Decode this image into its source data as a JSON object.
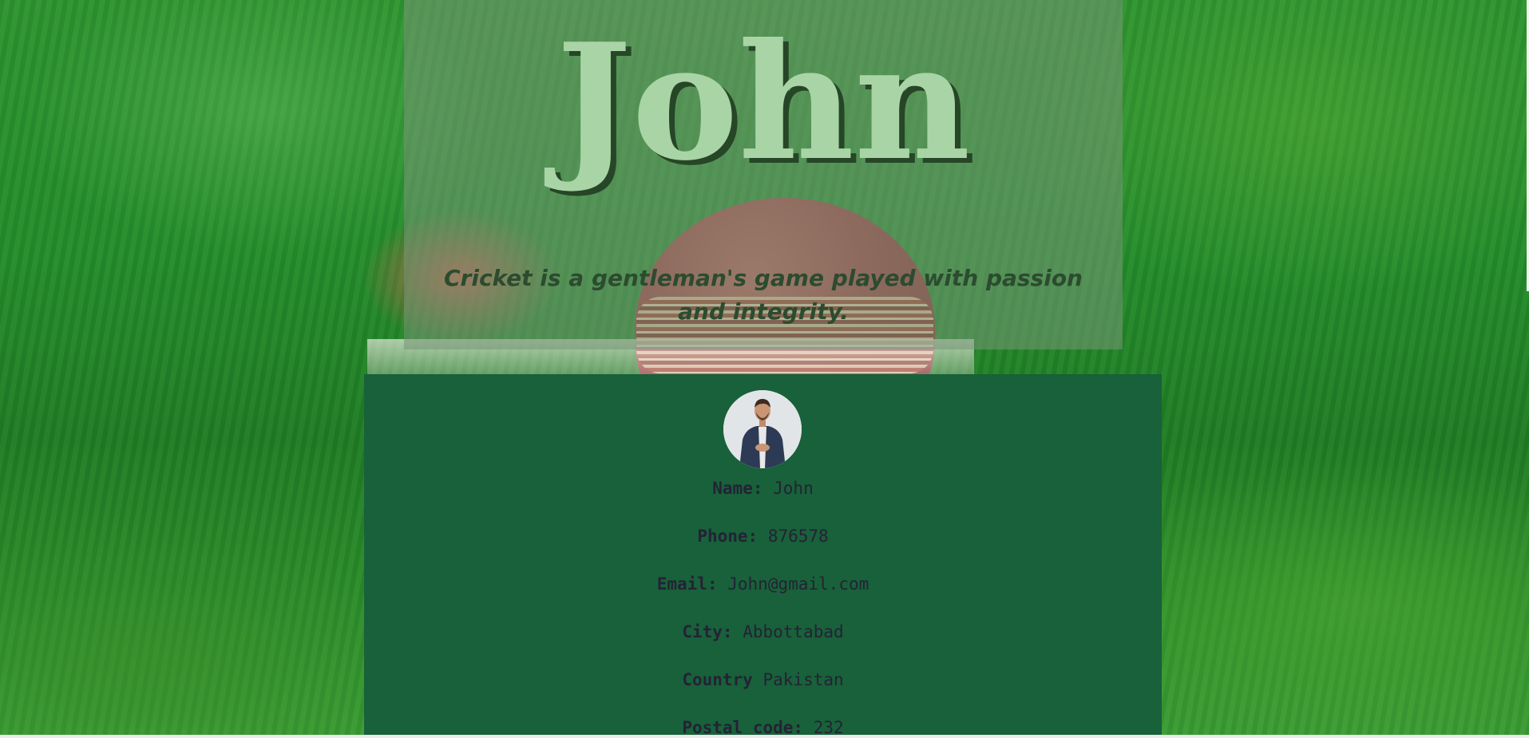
{
  "hero": {
    "title": "John",
    "tagline": "Cricket is a gentleman's game played with passion and integrity."
  },
  "profile": {
    "fields": [
      {
        "label": "Name:",
        "value": "John"
      },
      {
        "label": "Phone:",
        "value": "876578"
      },
      {
        "label": "Email:",
        "value": "John@gmail.com"
      },
      {
        "label": "City:",
        "value": "Abbottabad"
      },
      {
        "label": "Country",
        "value": "Pakistan"
      },
      {
        "label": "Postal code:",
        "value": "232"
      }
    ]
  },
  "colors": {
    "card_background": "#18613a",
    "title_fill": "#a9d5a6",
    "title_shadow": "#264627",
    "text_dark": "#252236"
  },
  "icons": {
    "avatar": "profile-photo"
  }
}
